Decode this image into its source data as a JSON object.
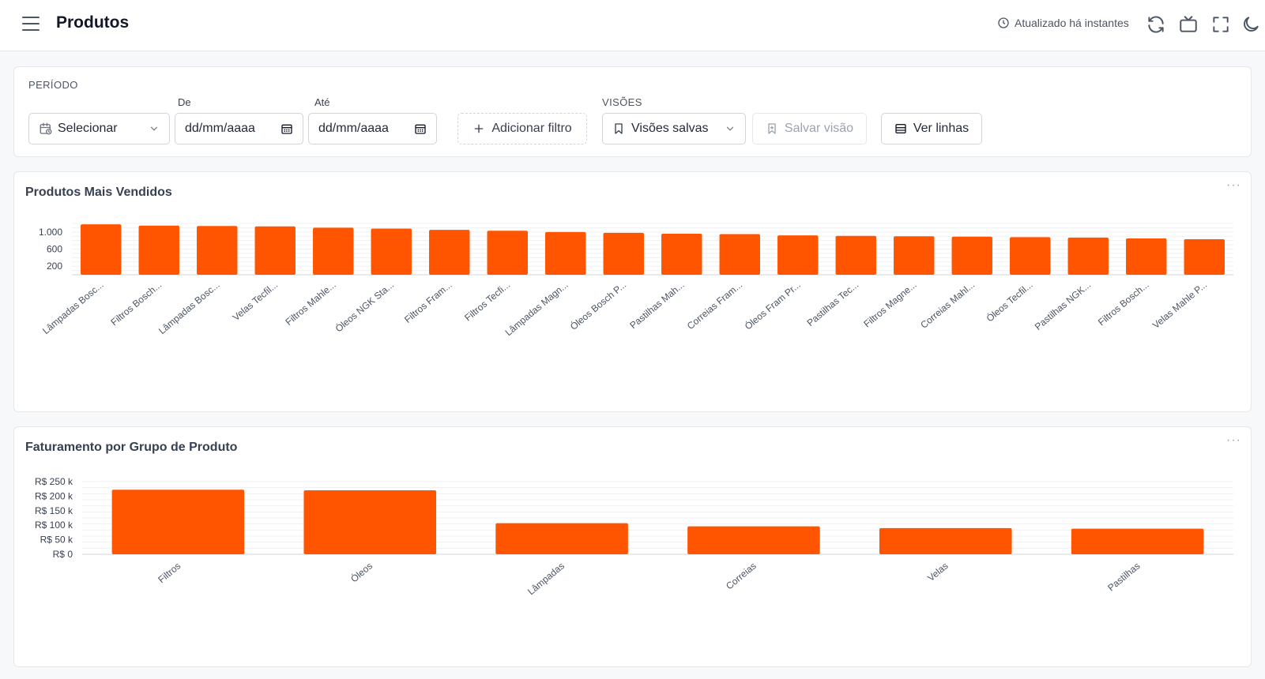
{
  "header": {
    "title": "Produtos",
    "updated_text": "Atualizado há instantes",
    "icons": [
      "menu-icon",
      "clock-icon",
      "refresh-icon",
      "tv-icon",
      "fullscreen-icon",
      "dark-mode-icon"
    ]
  },
  "filters": {
    "periodo_label": "PERÍODO",
    "periodo_value": "Selecionar",
    "de_label": "De",
    "de_placeholder": "dd/mm/aaaa",
    "ate_label": "Até",
    "ate_placeholder": "dd/mm/aaaa",
    "add_filter": "Adicionar filtro",
    "visoes_label": "VISÕES",
    "saved_views": "Visões salvas",
    "save_view": "Salvar visão",
    "view_rows": "Ver linhas"
  },
  "colors": {
    "bar": "#ff5500",
    "accent": "#ff5500"
  },
  "chart_data": [
    {
      "type": "bar",
      "title": "Produtos Mais Vendidos",
      "categories": [
        "Lâmpadas Bosc...",
        "Filtros Bosch...",
        "Lâmpadas Bosc...",
        "Velas Tecfil...",
        "Filtros Mahle...",
        "Óleos NGK Sta...",
        "Filtros Fram...",
        "Filtros Tecfi...",
        "Lâmpadas Magn...",
        "Óleos Bosch P...",
        "Pastilhas Mah...",
        "Correias Fram...",
        "Óleos Fram Pr...",
        "Pastilhas Tec...",
        "Filtros Magne...",
        "Correias Mahl...",
        "Óleos Tecfil...",
        "Pastilhas NGK...",
        "Filtros Bosch...",
        "Velas Mahle P..."
      ],
      "values": [
        1180,
        1150,
        1140,
        1130,
        1100,
        1080,
        1050,
        1030,
        1000,
        980,
        960,
        950,
        920,
        910,
        900,
        890,
        880,
        870,
        850,
        830
      ],
      "yticks": [
        "1.000",
        "600",
        "200"
      ],
      "ytick_values": [
        1000,
        600,
        200
      ],
      "ylim": [
        0,
        1200
      ],
      "grid": true
    },
    {
      "type": "bar",
      "title": "Faturamento por Grupo de Produto",
      "categories": [
        "Filtros",
        "Óleos",
        "Lâmpadas",
        "Correias",
        "Velas",
        "Pastilhas"
      ],
      "values": [
        222000,
        220000,
        107000,
        96000,
        90000,
        88000
      ],
      "yticks": [
        "R$ 250 k",
        "R$ 200 k",
        "R$ 150 k",
        "R$ 100 k",
        "R$ 50 k",
        "R$ 0"
      ],
      "ytick_values": [
        250000,
        200000,
        150000,
        100000,
        50000,
        0
      ],
      "ylim": [
        0,
        250000
      ],
      "grid": true
    }
  ]
}
